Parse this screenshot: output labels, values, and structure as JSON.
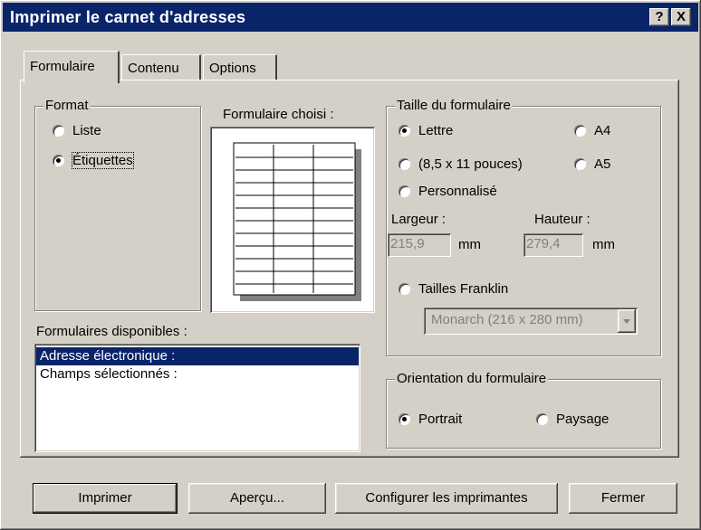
{
  "window": {
    "title": "Imprimer le carnet d'adresses",
    "help_label": "?",
    "close_label": "X"
  },
  "tabs": [
    {
      "label": "Formulaire",
      "active": true
    },
    {
      "label": "Contenu",
      "active": false
    },
    {
      "label": "Options",
      "active": false
    }
  ],
  "format": {
    "legend": "Format",
    "options": [
      {
        "label": "Liste",
        "selected": false
      },
      {
        "label": "Étiquettes",
        "selected": true
      }
    ]
  },
  "preview": {
    "label": "Formulaire choisi :"
  },
  "size": {
    "legend": "Taille du formulaire",
    "options": {
      "letter": {
        "label": "Lettre",
        "selected": true
      },
      "letter_desc": {
        "label": "(8,5 x 11 pouces)",
        "selected": false
      },
      "a4": {
        "label": "A4",
        "selected": false
      },
      "a5": {
        "label": "A5",
        "selected": false
      },
      "custom": {
        "label": "Personnalisé",
        "selected": false
      },
      "franklin": {
        "label": "Tailles Franklin",
        "selected": false
      }
    },
    "width_label": "Largeur :",
    "width_value": "215,9",
    "width_unit": "mm",
    "height_label": "Hauteur :",
    "height_value": "279,4",
    "height_unit": "mm",
    "franklin_select": "Monarch  (216 x 280 mm)"
  },
  "available": {
    "label": "Formulaires disponibles :",
    "items": [
      {
        "label": "Adresse électronique :",
        "selected": true
      },
      {
        "label": "Champs sélectionnés :",
        "selected": false
      }
    ]
  },
  "orientation": {
    "legend": "Orientation du formulaire",
    "portrait": {
      "label": "Portrait",
      "selected": true
    },
    "landscape": {
      "label": "Paysage",
      "selected": false
    }
  },
  "buttons": {
    "print": "Imprimer",
    "preview": "Aperçu...",
    "setup": "Configurer les imprimantes",
    "close": "Fermer"
  }
}
